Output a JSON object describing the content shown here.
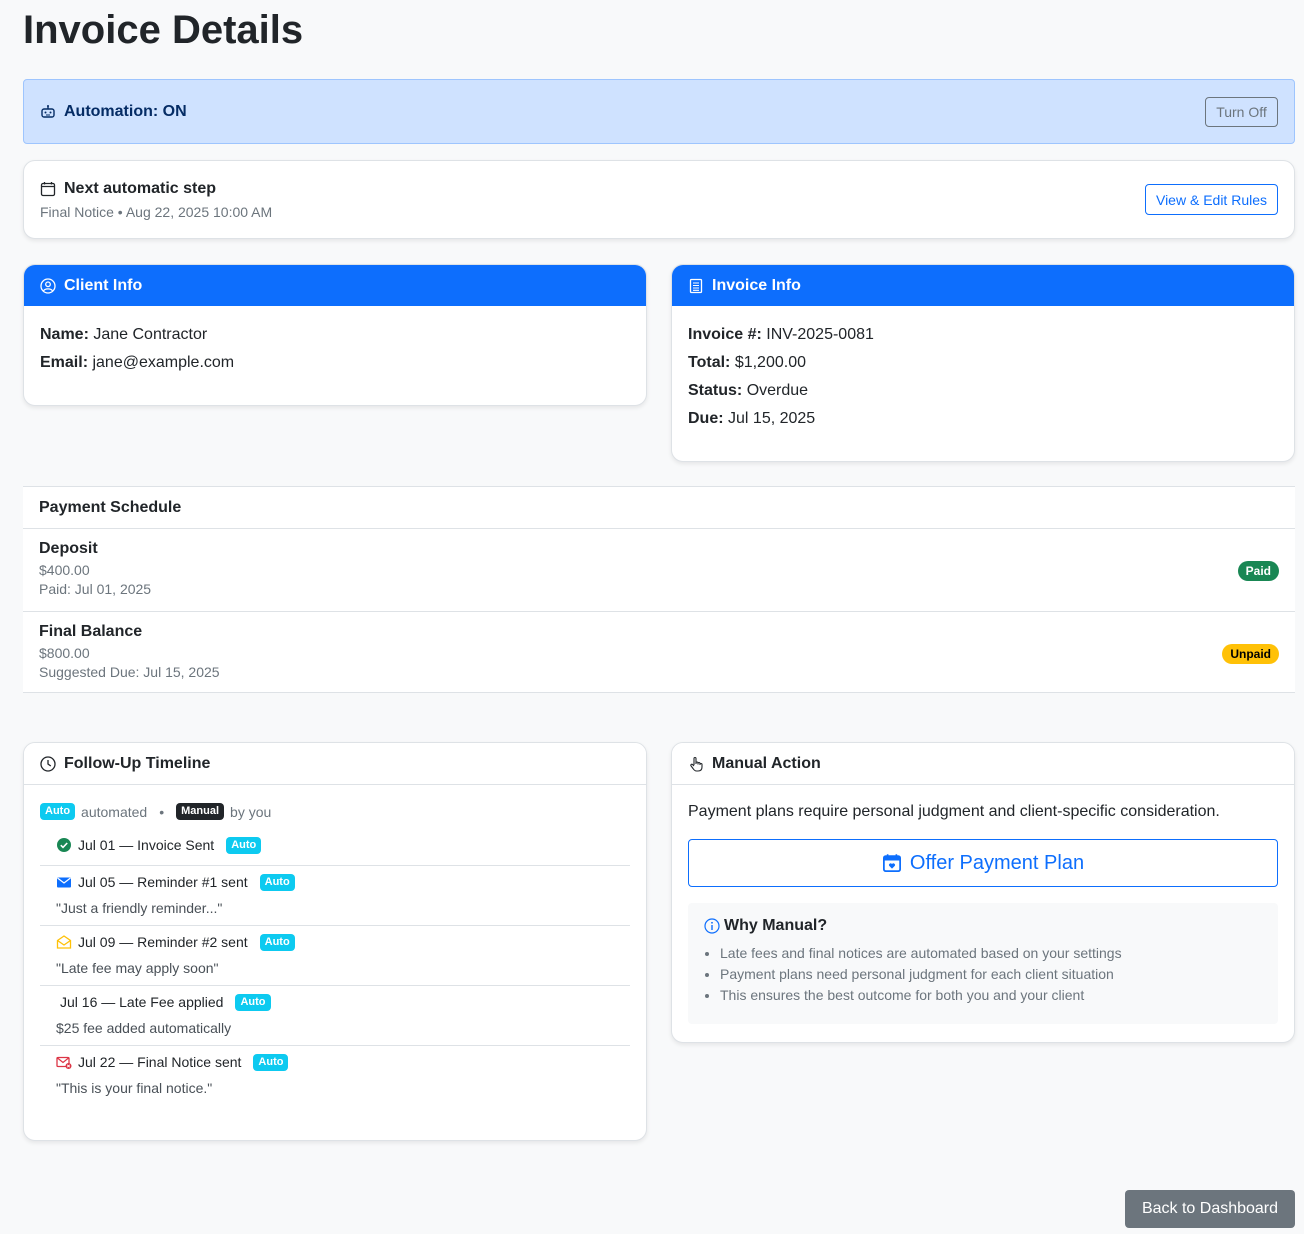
{
  "page": {
    "title": "Invoice Details"
  },
  "automation": {
    "label": "Automation: ON",
    "toggle_label": "Turn Off",
    "icon": "robot-icon"
  },
  "next_step": {
    "title": "Next automatic step",
    "subtitle": "Final Notice • Aug 22, 2025 10:00 AM",
    "button_label": "View & Edit Rules",
    "icon": "calendar-icon"
  },
  "client_info": {
    "header": "Client Info",
    "name_label": "Name:",
    "name_value": "Jane Contractor",
    "email_label": "Email:",
    "email_value": "jane@example.com"
  },
  "invoice_info": {
    "header": "Invoice Info",
    "number_label": "Invoice #:",
    "number_value": "INV-2025-0081",
    "total_label": "Total:",
    "total_value": "$1,200.00",
    "status_label": "Status:",
    "status_value": "Overdue",
    "due_label": "Due:",
    "due_value": "Jul 15, 2025"
  },
  "payment_schedule": {
    "header": "Payment Schedule",
    "items": [
      {
        "name": "Deposit",
        "amount": "$400.00",
        "note": "Paid: Jul 01, 2025",
        "status": "Paid"
      },
      {
        "name": "Final Balance",
        "amount": "$800.00",
        "note": "Suggested Due: Jul 15, 2025",
        "status": "Unpaid"
      }
    ]
  },
  "timeline": {
    "header": "Follow-Up Timeline",
    "legend": {
      "auto_badge": "Auto",
      "auto_text": "automated",
      "separator": "•",
      "manual_badge": "Manual",
      "manual_text": "by you"
    },
    "items": [
      {
        "text": "Jul 01 — Invoice Sent",
        "badge": "Auto",
        "quote": "",
        "icon": "check-circle-icon"
      },
      {
        "text": "Jul 05 — Reminder #1 sent",
        "badge": "Auto",
        "quote": "\"Just a friendly reminder...\"",
        "icon": "envelope-icon"
      },
      {
        "text": "Jul 09 — Reminder #2 sent",
        "badge": "Auto",
        "quote": "\"Late fee may apply soon\"",
        "icon": "envelope-open-icon"
      },
      {
        "text": "Jul 16 — Late Fee applied",
        "badge": "Auto",
        "quote": "$25 fee added automatically",
        "icon": ""
      },
      {
        "text": "Jul 22 — Final Notice sent",
        "badge": "Auto",
        "quote": "\"This is your final notice.\"",
        "icon": "envelope-x-icon"
      }
    ]
  },
  "manual_action": {
    "header": "Manual Action",
    "description": "Payment plans require personal judgment and client-specific consideration.",
    "button_label": "Offer Payment Plan",
    "why_title": "Why Manual?",
    "reasons": [
      "Late fees and final notices are automated based on your settings",
      "Payment plans need personal judgment for each client situation",
      "This ensures the best outcome for both you and your client"
    ]
  },
  "footer": {
    "back_label": "Back to Dashboard"
  },
  "colors": {
    "primary": "#0d6efd",
    "success": "#198754",
    "warning": "#ffc107",
    "info": "#0dcaf0",
    "secondary": "#6c757d"
  }
}
